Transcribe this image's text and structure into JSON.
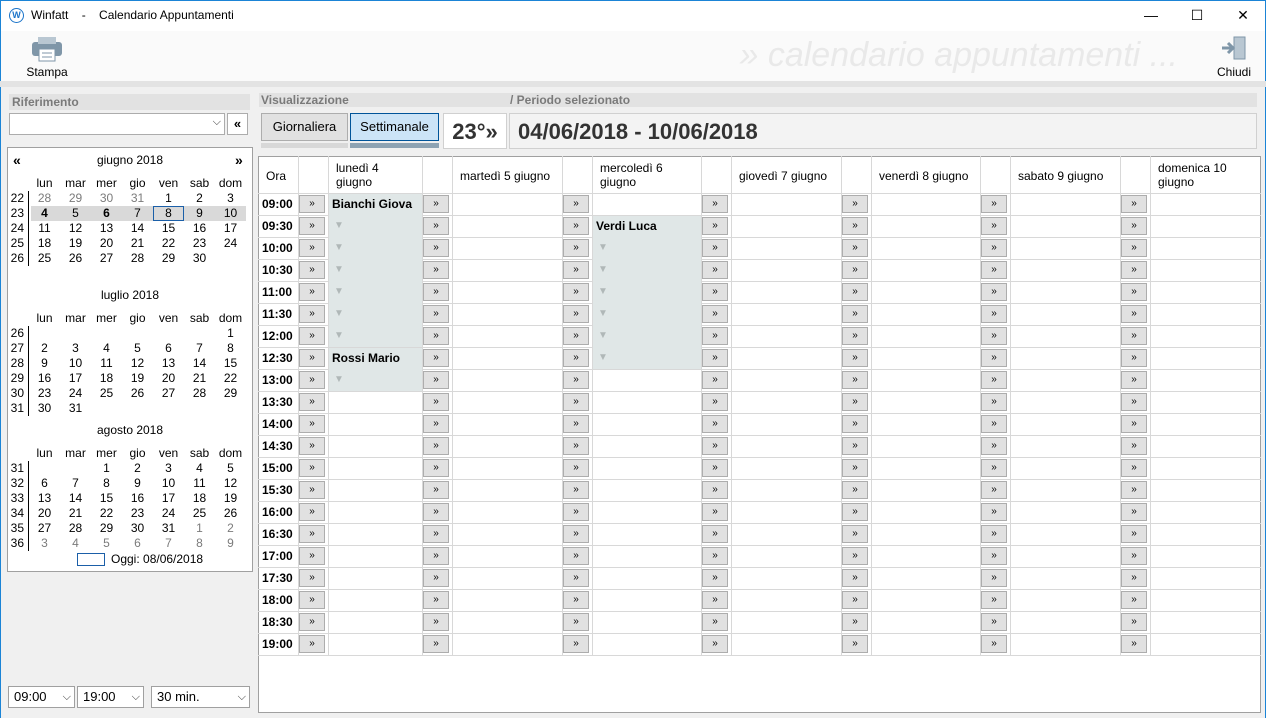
{
  "window": {
    "app_name": "Winfatt",
    "separator": "-",
    "title": "Calendario Appuntamenti",
    "icon": "W",
    "controls": {
      "minimize": "—",
      "maximize": "☐",
      "close": "✕"
    }
  },
  "toolbar": {
    "print_label": "Stampa",
    "watermark": "» calendario appuntamenti ...",
    "close_label": "Chiudi"
  },
  "left": {
    "riferimento_label": "Riferimento",
    "riferimento_value": "",
    "prev_button": "«",
    "nav_prev": "«",
    "nav_next": "»",
    "dow": [
      "lun",
      "mar",
      "mer",
      "gio",
      "ven",
      "sab",
      "dom"
    ],
    "months": [
      {
        "title": "giugno 2018",
        "weeks": [
          {
            "wk": "22",
            "days": [
              "28",
              "29",
              "30",
              "31",
              "1",
              "2",
              "3"
            ]
          },
          {
            "wk": "23",
            "days": [
              "4",
              "5",
              "6",
              "7",
              "8",
              "9",
              "10"
            ]
          },
          {
            "wk": "24",
            "days": [
              "11",
              "12",
              "13",
              "14",
              "15",
              "16",
              "17"
            ]
          },
          {
            "wk": "25",
            "days": [
              "18",
              "19",
              "20",
              "21",
              "22",
              "23",
              "24"
            ]
          },
          {
            "wk": "26",
            "days": [
              "25",
              "26",
              "27",
              "28",
              "29",
              "30",
              ""
            ]
          }
        ]
      },
      {
        "title": "luglio 2018",
        "weeks": [
          {
            "wk": "26",
            "days": [
              "",
              "",
              "",
              "",
              "",
              "",
              "1"
            ]
          },
          {
            "wk": "27",
            "days": [
              "2",
              "3",
              "4",
              "5",
              "6",
              "7",
              "8"
            ]
          },
          {
            "wk": "28",
            "days": [
              "9",
              "10",
              "11",
              "12",
              "13",
              "14",
              "15"
            ]
          },
          {
            "wk": "29",
            "days": [
              "16",
              "17",
              "18",
              "19",
              "20",
              "21",
              "22"
            ]
          },
          {
            "wk": "30",
            "days": [
              "23",
              "24",
              "25",
              "26",
              "27",
              "28",
              "29"
            ]
          },
          {
            "wk": "31",
            "days": [
              "30",
              "31",
              "",
              "",
              "",
              "",
              ""
            ]
          }
        ]
      },
      {
        "title": "agosto 2018",
        "weeks": [
          {
            "wk": "31",
            "days": [
              "",
              "",
              "1",
              "2",
              "3",
              "4",
              "5"
            ]
          },
          {
            "wk": "32",
            "days": [
              "6",
              "7",
              "8",
              "9",
              "10",
              "11",
              "12"
            ]
          },
          {
            "wk": "33",
            "days": [
              "13",
              "14",
              "15",
              "16",
              "17",
              "18",
              "19"
            ]
          },
          {
            "wk": "34",
            "days": [
              "20",
              "21",
              "22",
              "23",
              "24",
              "25",
              "26"
            ]
          },
          {
            "wk": "35",
            "days": [
              "27",
              "28",
              "29",
              "30",
              "31",
              "1",
              "2"
            ]
          },
          {
            "wk": "36",
            "days": [
              "3",
              "4",
              "5",
              "6",
              "7",
              "8",
              "9"
            ]
          }
        ]
      }
    ],
    "today_label": "Oggi: 08/06/2018",
    "start_time": "09:00",
    "end_time": "19:00",
    "interval": "30 min."
  },
  "view": {
    "visualizzazione_label": "Visualizzazione",
    "periodo_label": "/ Periodo selezionato",
    "daily_label": "Giornaliera",
    "weekly_label": "Settimanale",
    "active_view": "weekly",
    "week_number": "23°»",
    "period": "04/06/2018 - 10/06/2018"
  },
  "grid": {
    "ora_header": "Ora",
    "days": [
      {
        "line1": "lunedì 4",
        "line2": "giugno"
      },
      {
        "line1": "martedì 5 giugno",
        "line2": ""
      },
      {
        "line1": "mercoledì 6",
        "line2": "giugno"
      },
      {
        "line1": "giovedì 7 giugno",
        "line2": ""
      },
      {
        "line1": "venerdì 8 giugno",
        "line2": ""
      },
      {
        "line1": "sabato 9 giugno",
        "line2": ""
      },
      {
        "line1": "domenica 10",
        "line2": "giugno"
      }
    ],
    "times": [
      "09:00",
      "09:30",
      "10:00",
      "10:30",
      "11:00",
      "11:30",
      "12:00",
      "12:30",
      "13:00",
      "13:30",
      "14:00",
      "14:30",
      "15:00",
      "15:30",
      "16:00",
      "16:30",
      "17:00",
      "17:30",
      "18:00",
      "18:30",
      "19:00"
    ],
    "slot_button": "»",
    "continuation_mark": "▼",
    "appointments": [
      {
        "day": 0,
        "start": "09:00",
        "slots": 7,
        "name": "Bianchi Giova"
      },
      {
        "day": 0,
        "start": "12:30",
        "slots": 2,
        "name": "Rossi Mario"
      },
      {
        "day": 2,
        "start": "09:30",
        "slots": 7,
        "name": "Verdi Luca"
      }
    ]
  }
}
